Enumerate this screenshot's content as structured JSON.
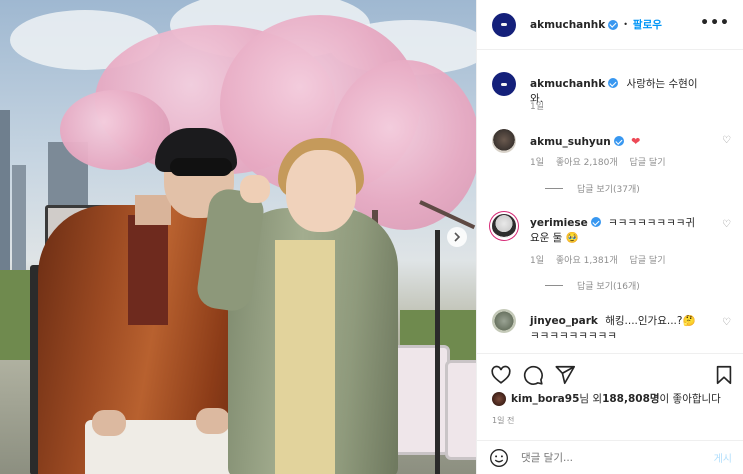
{
  "header": {
    "username": "akmuchanhk",
    "separator": "•",
    "follow_label": "팔로우",
    "more_label": "•••"
  },
  "caption": {
    "username": "akmuchanhk",
    "text": "사랑하는 수현이와.",
    "age": "1일"
  },
  "comments": [
    {
      "username": "akmu_suhyun",
      "text": "",
      "emoji": "❤",
      "age": "1일",
      "likes": "좋아요 2,180개",
      "reply_label": "답글 달기",
      "view_replies": "답글 보기(37개)"
    },
    {
      "username": "yerimiese",
      "text": "ㅋㅋㅋㅋㅋㅋㅋㅋ귀요운 둘 ",
      "emoji": "🥹",
      "age": "1일",
      "likes": "좋아요 1,381개",
      "reply_label": "답글 달기",
      "view_replies": "답글 보기(16개)"
    },
    {
      "username": "jinyeo_park",
      "text": "해킹....인가요...?",
      "emoji": "🤔",
      "tail": "ㅋㅋㅋㅋㅋㅋㅋㅋㅋ",
      "age": "",
      "likes": "",
      "reply_label": ""
    }
  ],
  "likes": {
    "username": "kim_bora95",
    "suffix_1": "님 외 ",
    "count": "188,808명",
    "suffix_2": "이 좋아합니다"
  },
  "post_time": "1일 전",
  "add_comment": {
    "placeholder": "댓글 달기...",
    "post_label": "게시"
  },
  "icons": {
    "like": "heart-icon",
    "comment": "comment-icon",
    "share": "paper-plane-icon",
    "save": "bookmark-icon",
    "emoji": "emoji-icon",
    "next": "chevron-right-icon"
  },
  "colors": {
    "link_blue": "#0095f6",
    "verified_blue": "#3897f0",
    "meta_gray": "#8e8e8e",
    "heart_red": "#ed4956",
    "avatar_navy": "#14207a"
  }
}
